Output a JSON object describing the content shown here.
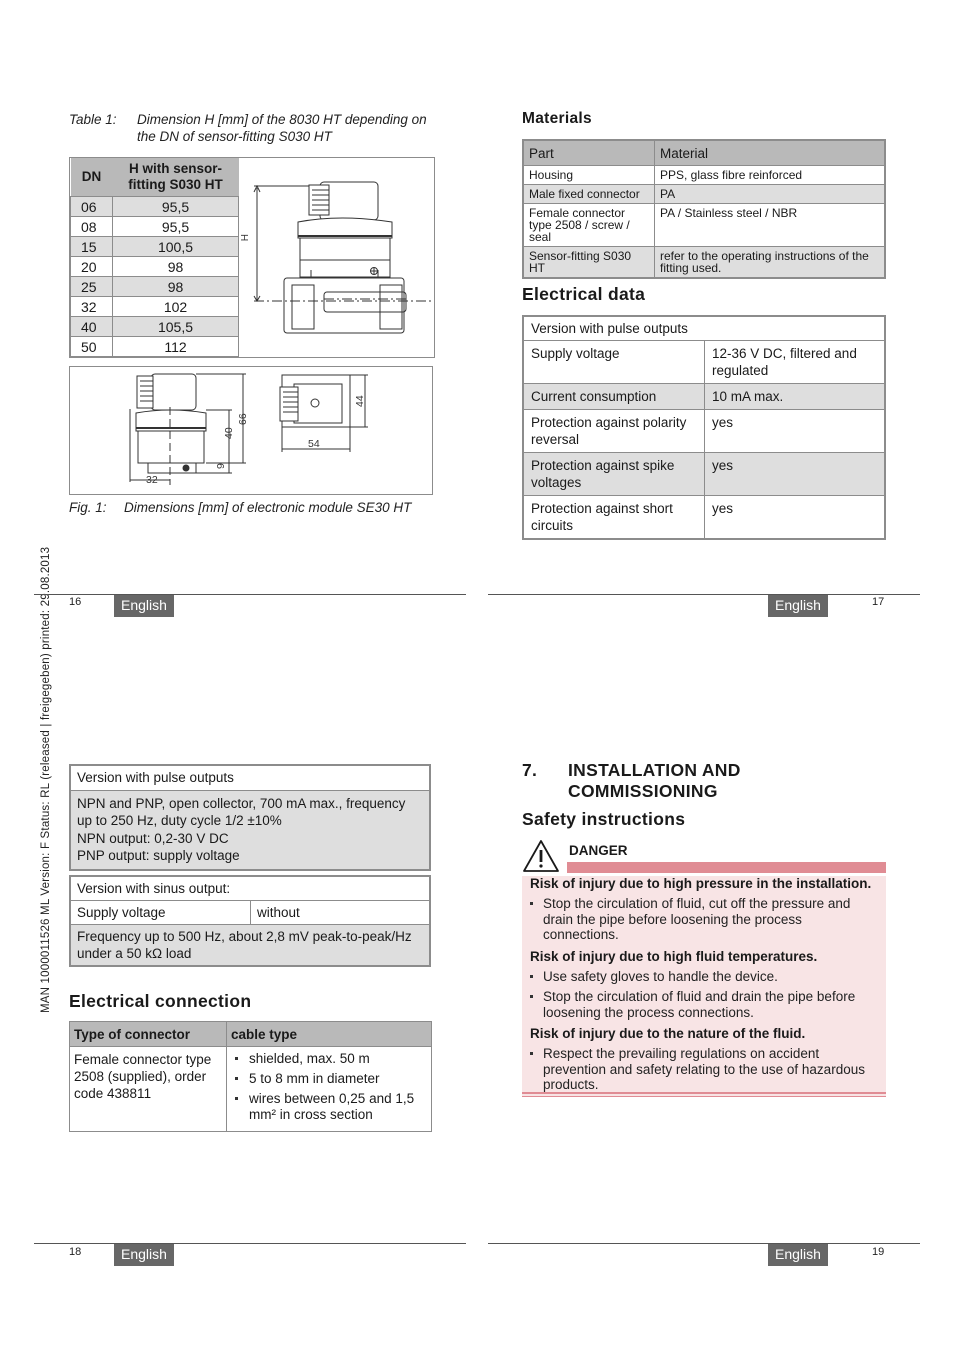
{
  "side_margin_text": "MAN  1000011526  ML  Version: F  Status: RL (released | freigegeben)  printed: 29.08.2013",
  "page16": {
    "table1_caption_label": "Table 1:",
    "table1_caption_text": "Dimension H [mm] of the 8030 HT depending on the DN of sensor-fitting S030 HT",
    "table1": {
      "headers": [
        "DN",
        "H with sensor-fitting S030 HT"
      ],
      "rows": [
        [
          "06",
          "95,5"
        ],
        [
          "08",
          "95,5"
        ],
        [
          "15",
          "100,5"
        ],
        [
          "20",
          "98"
        ],
        [
          "25",
          "98"
        ],
        [
          "32",
          "102"
        ],
        [
          "40",
          "105,5"
        ],
        [
          "50",
          "112"
        ]
      ]
    },
    "drawing_label_h": "H",
    "fig1_dims": {
      "d66": "66",
      "d40": "40",
      "d9": "9",
      "d32": "32",
      "d54": "54",
      "d44": "44"
    },
    "fig1_caption_label": "Fig. 1:",
    "fig1_caption_text": "Dimensions [mm] of electronic module SE30 HT",
    "page_number": "16",
    "language": "English"
  },
  "page17": {
    "materials_title": "Materials",
    "materials": {
      "headers": [
        "Part",
        "Material"
      ],
      "rows": [
        [
          "Housing",
          "PPS, glass fibre reinforced"
        ],
        [
          "Male fixed connector",
          "PA"
        ],
        [
          "Female connector type 2508 / screw / seal",
          "PA / Stainless steel / NBR"
        ],
        [
          "Sensor-fitting S030 HT",
          "refer to the operating instructions of the fitting used."
        ]
      ]
    },
    "electrical_title": "Electrical data",
    "electrical": {
      "header": "Version with pulse outputs",
      "rows": [
        [
          "Supply voltage",
          "12-36 V DC, filtered and regulated"
        ],
        [
          "Current consumption",
          "10 mA max."
        ],
        [
          "Protection against polarity reversal",
          "yes"
        ],
        [
          "Protection against spike voltages",
          "yes"
        ],
        [
          "Protection against short circuits",
          "yes"
        ]
      ]
    },
    "page_number": "17",
    "language": "English"
  },
  "page18": {
    "pulse": {
      "header": "Version with pulse outputs",
      "lines": [
        "NPN and PNP, open collector, 700 mA max., frequency up to 250 Hz, duty cycle 1/2 ±10%",
        "NPN output: 0,2-30 V DC",
        "PNP output: supply voltage"
      ]
    },
    "sinus": {
      "header": "Version with sinus output:",
      "supply_label": "Supply voltage",
      "supply_value": "without",
      "frequency": "Frequency up to 500 Hz, about 2,8 mV peak-to-peak/Hz under a 50 kΩ load"
    },
    "connection_title": "Electrical connection",
    "connection": {
      "headers": [
        "Type of connector",
        "cable type"
      ],
      "connector": "Female connector type 2508 (supplied), order code 438811",
      "cable_items": [
        "shielded, max. 50 m",
        "5 to 8 mm in diameter",
        "wires between 0,25 and 1,5 mm² in cross section"
      ]
    },
    "page_number": "18",
    "language": "English"
  },
  "page19": {
    "chapter_number": "7.",
    "chapter_title_line1": "INSTALLATION AND",
    "chapter_title_line2": "COMMISSIONING",
    "safety_title": "Safety instructions",
    "danger_label": "DANGER",
    "risks": [
      {
        "title": "Risk of injury due to high pressure in the installation.",
        "bullets": [
          "Stop the circulation of fluid, cut off the pressure and drain the pipe before loosening the process connections."
        ]
      },
      {
        "title": "Risk of injury due to high fluid temperatures.",
        "bullets": [
          "Use safety gloves to handle the device.",
          "Stop the circulation of fluid and drain the pipe before loosening the process connections."
        ]
      },
      {
        "title": "Risk of injury due to the nature of the fluid.",
        "bullets": [
          "Respect the prevailing regulations on accident prevention and safety relating to the use of hazardous products."
        ]
      }
    ],
    "colors": {
      "danger_bar": "#e08c94",
      "danger_bg": "#f8e4e5",
      "language_tab": "#676767"
    },
    "page_number": "19",
    "language": "English"
  }
}
